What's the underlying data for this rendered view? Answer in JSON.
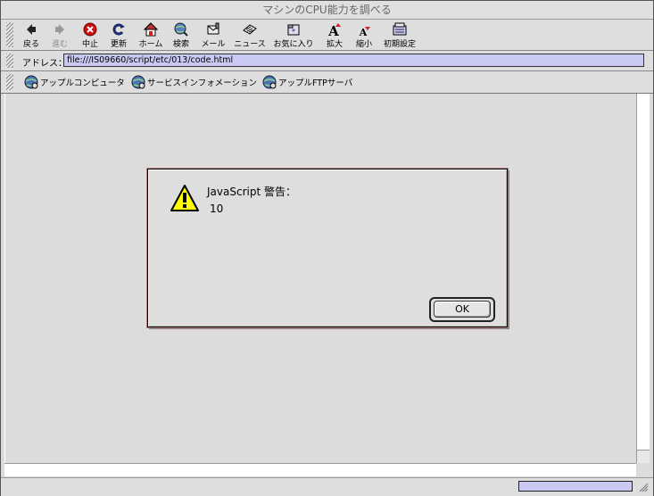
{
  "window": {
    "title": "マシンのCPU能力を調べる"
  },
  "toolbar": {
    "back": "戻る",
    "forward": "進む",
    "stop": "中止",
    "reload": "更新",
    "home": "ホーム",
    "search": "検索",
    "mail": "メール",
    "news": "ニュース",
    "favorites": "お気に入り",
    "enlarge": "拡大",
    "shrink": "縮小",
    "prefs": "初期設定"
  },
  "address": {
    "label": "アドレス：",
    "value": "file:///IS09660/script/etc/013/code.html"
  },
  "bookmarks": [
    "アップルコンピュータ",
    "サービスインフォメーション",
    "アップルFTPサーバ"
  ],
  "dialog": {
    "title": "JavaScript 警告：",
    "message": "10",
    "ok": "OK"
  },
  "icons": {
    "back": "back-arrow-icon",
    "forward": "forward-arrow-icon",
    "stop": "stop-icon",
    "reload": "reload-icon",
    "home": "home-icon",
    "search": "globe-search-icon",
    "mail": "mail-icon",
    "news": "news-icon",
    "favorites": "favorites-icon",
    "enlarge": "text-enlarge-icon",
    "shrink": "text-shrink-icon",
    "prefs": "preferences-icon",
    "warning": "warning-icon"
  },
  "colors": {
    "address_field": "#c9c9f2",
    "progress_fill": "#c9c9f2",
    "stop_red": "#cc1111",
    "warning_yellow": "#ffff00"
  }
}
